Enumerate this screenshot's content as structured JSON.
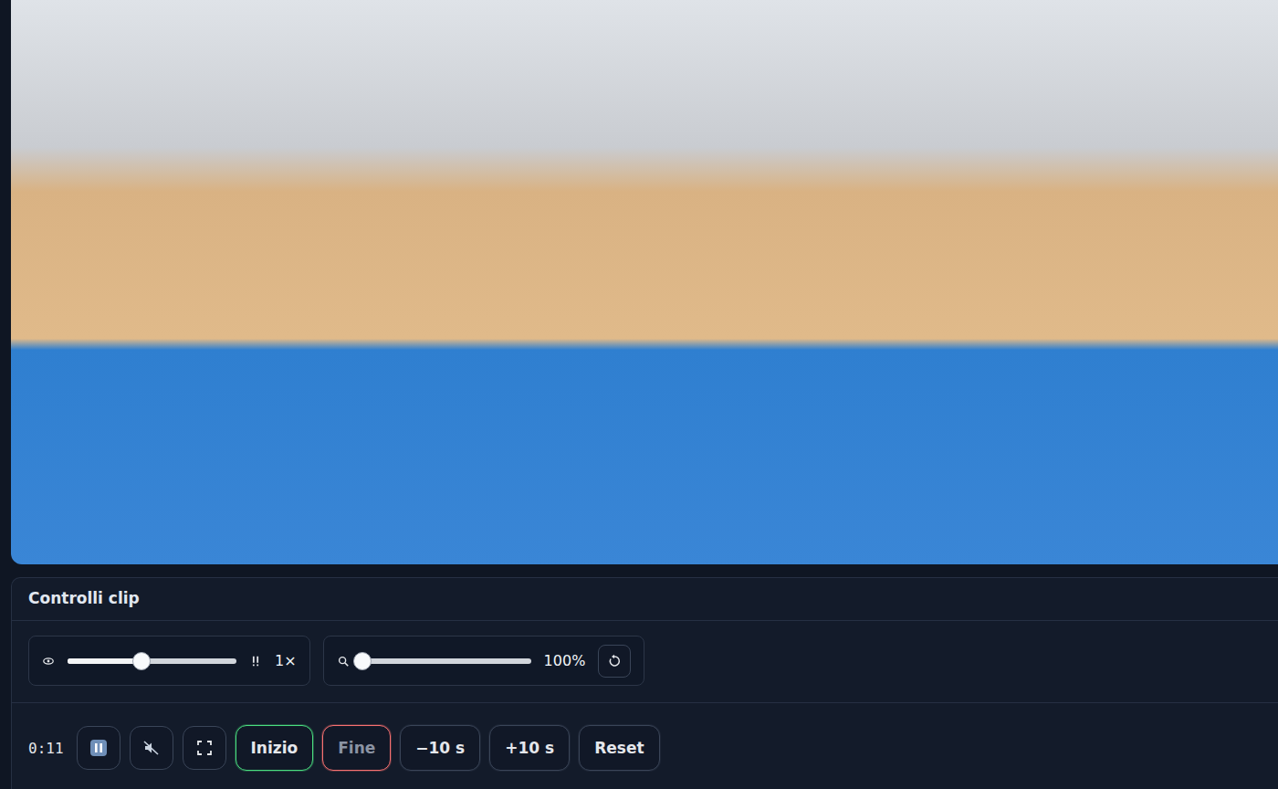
{
  "video": {
    "time": "0:11",
    "playing": true,
    "muted": true
  },
  "panel": {
    "title": "Controlli clip"
  },
  "speed": {
    "level": 0.44,
    "reading": "1×"
  },
  "zoom": {
    "level": 0,
    "reading": "100%"
  },
  "buttons": [
    {
      "label": "Inizio",
      "disabled": false,
      "color": "#4ade80"
    },
    {
      "label": "Fine",
      "disabled": true,
      "color": "#f87171"
    },
    {
      "label": "−10 s",
      "disabled": false,
      "color": "#3a4558"
    },
    {
      "label": "+10 s",
      "disabled": false,
      "color": "#3a4558"
    },
    {
      "label": "Reset",
      "disabled": false,
      "color": "#3a4558"
    }
  ]
}
